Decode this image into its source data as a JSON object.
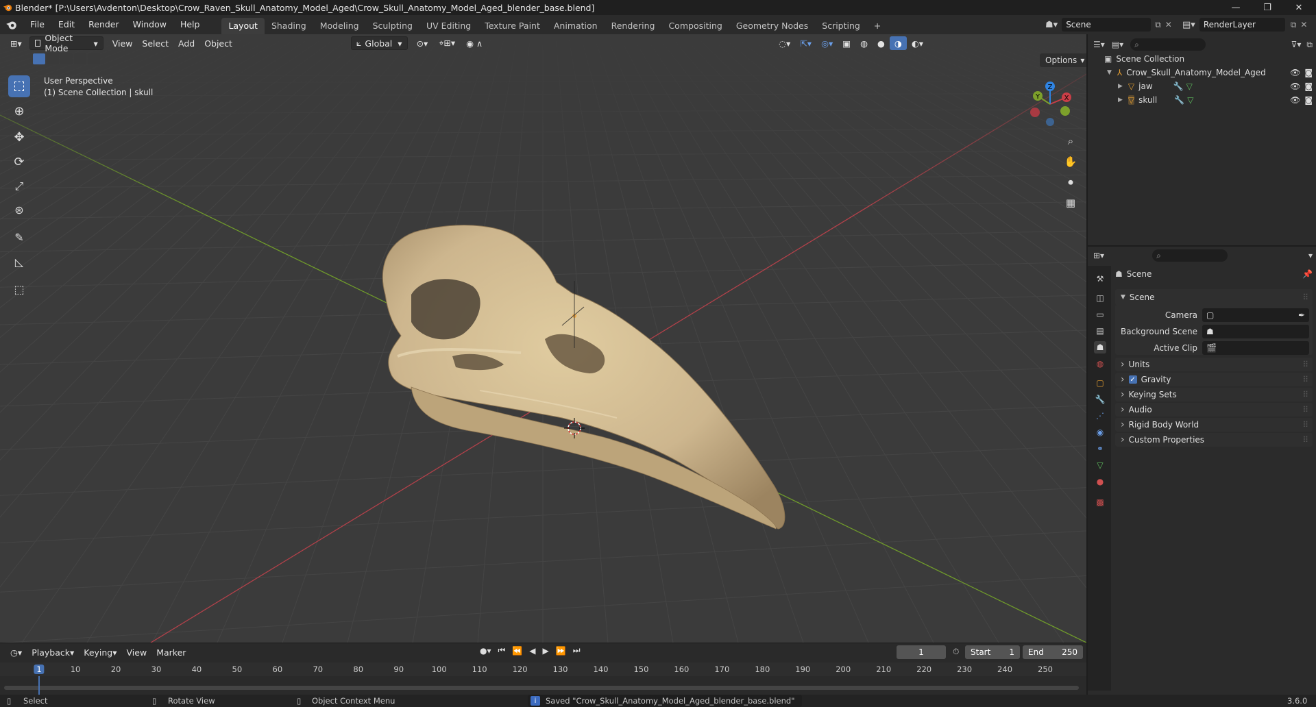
{
  "window": {
    "title": "Blender* [P:\\Users\\Avdenton\\Desktop\\Crow_Raven_Skull_Anatomy_Model_Aged\\Crow_Skull_Anatomy_Model_Aged_blender_base.blend]",
    "minimize": "—",
    "maximize": "❐",
    "close": "✕"
  },
  "menus": [
    "File",
    "Edit",
    "Render",
    "Window",
    "Help"
  ],
  "workspaces": [
    "Layout",
    "Shading",
    "Modeling",
    "Sculpting",
    "UV Editing",
    "Texture Paint",
    "Animation",
    "Rendering",
    "Compositing",
    "Geometry Nodes",
    "Scripting",
    "+"
  ],
  "active_workspace": "Layout",
  "scene_selector": "Scene",
  "view_layer": "RenderLayer",
  "viewport": {
    "mode": "Object Mode",
    "menus": [
      "View",
      "Select",
      "Add",
      "Object"
    ],
    "orientation": "Global",
    "options": "Options",
    "overlay_line1": "User Perspective",
    "overlay_line2": "(1) Scene Collection | skull",
    "gizmo_axes": {
      "x": "X",
      "y": "Y",
      "z": "Z"
    }
  },
  "outliner": {
    "root": "Scene Collection",
    "collection": "Crow_Skull_Anatomy_Model_Aged",
    "objects": [
      "jaw",
      "skull"
    ]
  },
  "properties": {
    "header": "Scene",
    "panel": "Scene",
    "fields": {
      "camera": "Camera",
      "background_scene": "Background Scene",
      "active_clip": "Active Clip"
    },
    "subpanels": [
      "Units",
      "Gravity",
      "Keying Sets",
      "Audio",
      "Rigid Body World",
      "Custom Properties"
    ],
    "gravity_checked": true
  },
  "timeline": {
    "menus": [
      "Playback",
      "Keying",
      "View",
      "Marker"
    ],
    "current_frame": "1",
    "start_label": "Start",
    "start": "1",
    "end_label": "End",
    "end": "250",
    "ruler": [
      "1",
      "10",
      "20",
      "30",
      "40",
      "50",
      "60",
      "70",
      "80",
      "90",
      "100",
      "110",
      "120",
      "130",
      "140",
      "150",
      "160",
      "170",
      "180",
      "190",
      "200",
      "210",
      "220",
      "230",
      "240",
      "250"
    ]
  },
  "status": {
    "select": "Select",
    "rotate": "Rotate View",
    "context": "Object Context Menu",
    "message": "Saved \"Crow_Skull_Anatomy_Model_Aged_blender_base.blend\"",
    "version": "3.6.0"
  },
  "colors": {
    "accent": "#4772b3",
    "x_axis": "#c93e47",
    "y_axis": "#7da02b",
    "z_axis": "#2f84e3",
    "bone": "#cdb68e"
  }
}
